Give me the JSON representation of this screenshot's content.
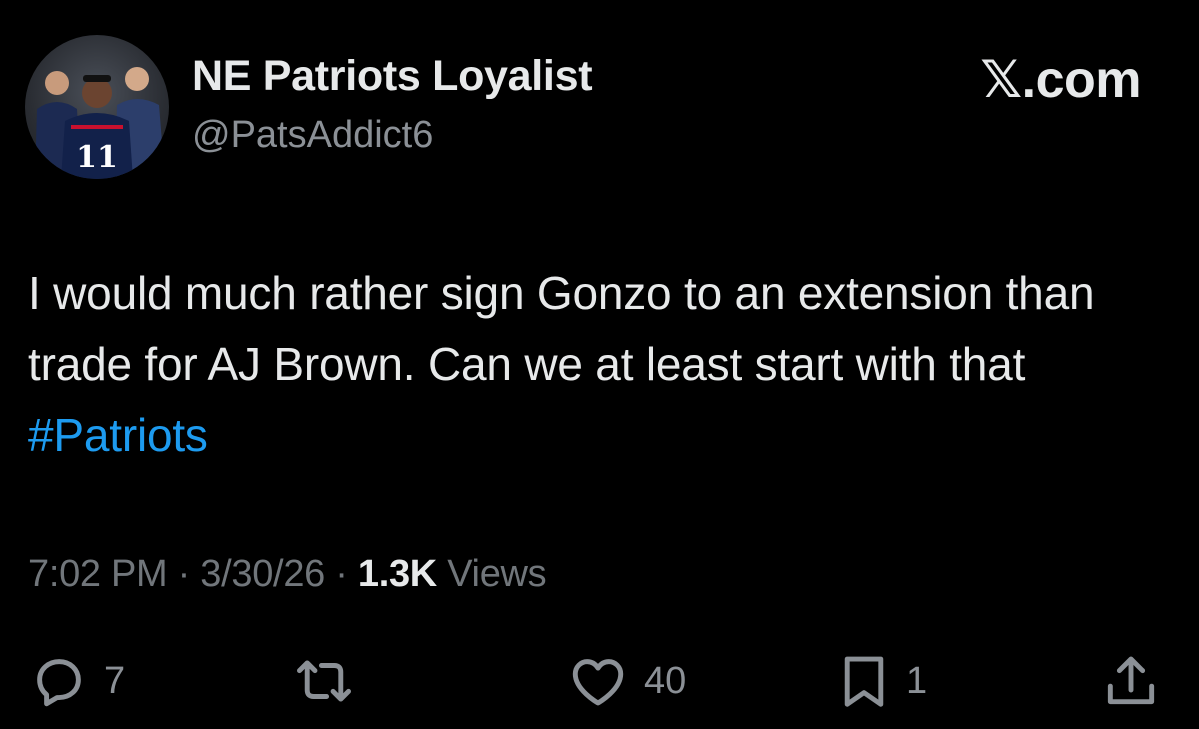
{
  "user": {
    "display_name": "NE Patriots Loyalist",
    "handle": "@PatsAddict6",
    "avatar_jersey_number": "11"
  },
  "brand": "𝕏.com",
  "tweet": {
    "text": "I would much rather sign Gonzo to an extension than trade for AJ Brown. Can we at least start with that",
    "hashtag": "#Patriots"
  },
  "meta": {
    "time": "7:02 PM",
    "sep1": " · ",
    "date": "3/30/26",
    "sep2": " · ",
    "views_count": "1.3K",
    "views_label": " Views"
  },
  "actions": {
    "replies": "7",
    "likes": "40",
    "bookmarks": "1"
  },
  "colors": {
    "background": "#000000",
    "text": "#e7e9ea",
    "muted": "#71767b",
    "hashtag": "#1d9bf0"
  },
  "icons": [
    "reply-icon",
    "retweet-icon",
    "like-icon",
    "bookmark-icon",
    "share-icon"
  ]
}
